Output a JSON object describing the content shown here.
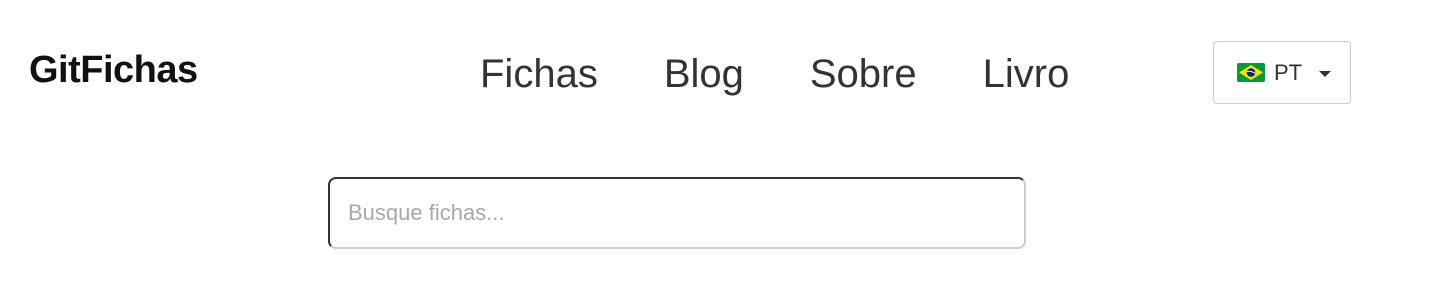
{
  "header": {
    "logo": "GitFichas",
    "nav": [
      {
        "label": "Fichas"
      },
      {
        "label": "Blog"
      },
      {
        "label": "Sobre"
      },
      {
        "label": "Livro"
      }
    ],
    "language": {
      "flag_icon": "brazil-flag-icon",
      "code": "PT",
      "dropdown_icon": "caret-down-icon"
    }
  },
  "search": {
    "value": "",
    "placeholder": "Busque fichas..."
  },
  "colors": {
    "text": "#333333",
    "logo": "#111111",
    "border": "#cccccc",
    "placeholder": "#a8a8a8",
    "flag_green": "#009c3b",
    "flag_yellow": "#ffdf00",
    "flag_blue": "#002776"
  }
}
